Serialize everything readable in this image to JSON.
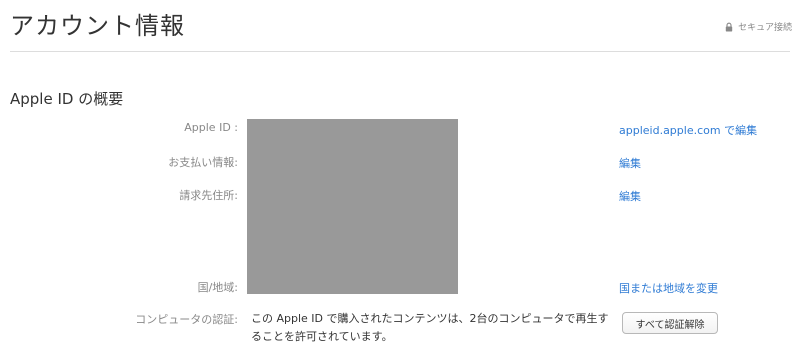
{
  "header": {
    "title": "アカウント情報",
    "secure_label": "セキュア接続"
  },
  "section": {
    "title": "Apple ID の概要"
  },
  "rows": {
    "apple_id": {
      "label": "Apple ID :",
      "action": "appleid.apple.com で編集"
    },
    "payment": {
      "label": "お支払い情報:",
      "action": "編集"
    },
    "billing": {
      "label": "請求先住所:",
      "action": "編集"
    },
    "country": {
      "label": "国/地域:",
      "action": "国または地域を変更"
    },
    "authorization": {
      "label": "コンピュータの認証:",
      "text": "この Apple ID で購入されたコンテンツは、2台のコンピュータで再生することを許可されています。",
      "button": "すべて認証解除"
    }
  },
  "colors": {
    "link": "#2f7bd4",
    "redacted": "#999999"
  }
}
